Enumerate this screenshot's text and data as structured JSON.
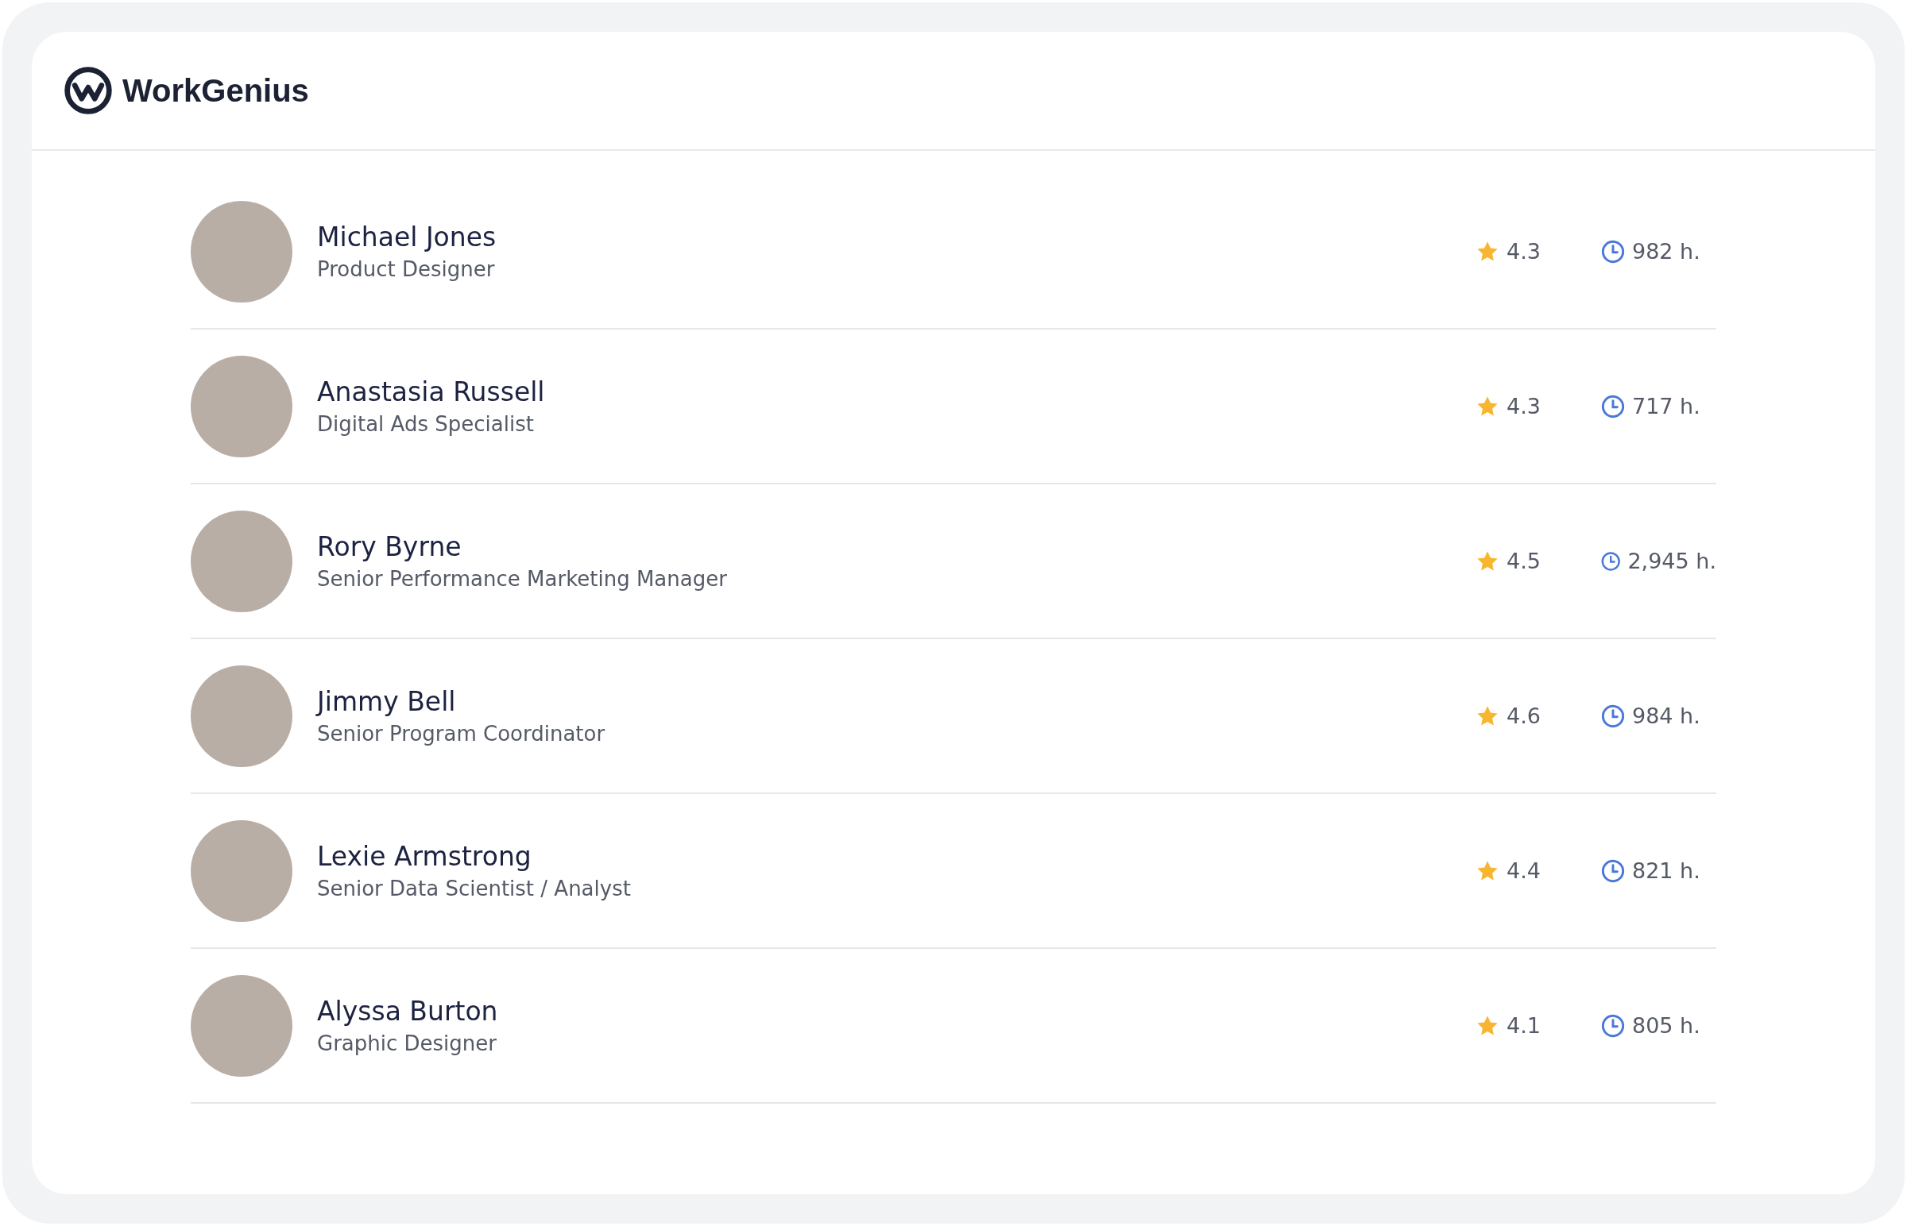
{
  "header": {
    "brand": "WorkGenius"
  },
  "people": [
    {
      "name": "Michael Jones",
      "role": "Product Designer",
      "rating": "4.3",
      "hours": "982 h."
    },
    {
      "name": "Anastasia Russell",
      "role": "Digital Ads Specialist",
      "rating": "4.3",
      "hours": "717 h."
    },
    {
      "name": "Rory Byrne",
      "role": "Senior Performance Marketing Manager",
      "rating": "4.5",
      "hours": "2,945 h."
    },
    {
      "name": "Jimmy Bell",
      "role": "Senior Program Coordinator",
      "rating": "4.6",
      "hours": "984 h."
    },
    {
      "name": "Lexie Armstrong",
      "role": "Senior Data Scientist / Analyst",
      "rating": "4.4",
      "hours": "821 h."
    },
    {
      "name": "Alyssa Burton",
      "role": "Graphic Designer",
      "rating": "4.1",
      "hours": "805 h."
    }
  ]
}
